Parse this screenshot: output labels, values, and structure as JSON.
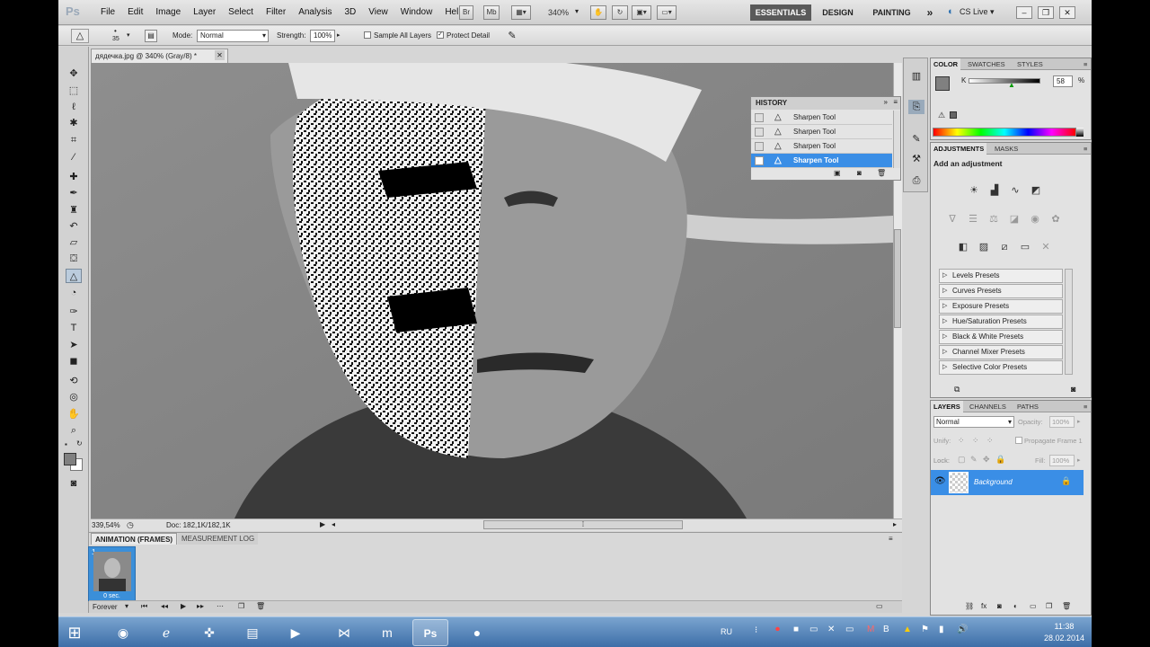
{
  "app": {
    "logo": "Ps",
    "menu": [
      "File",
      "Edit",
      "Image",
      "Layer",
      "Select",
      "Filter",
      "Analysis",
      "3D",
      "View",
      "Window",
      "Help"
    ],
    "zoom": "340%",
    "workspaces": [
      "ESSENTIALS",
      "DESIGN",
      "PAINTING"
    ],
    "more": "»",
    "cslive": "CS Live ▾"
  },
  "options": {
    "brush_size": "35",
    "mode_label": "Mode:",
    "mode_value": "Normal",
    "strength_label": "Strength:",
    "strength_value": "100%",
    "sample_all_layers": "Sample All Layers",
    "protect_detail": "Protect Detail"
  },
  "document": {
    "tab_title": "дядечка.jpg @ 340% (Gray/8) *",
    "zoom_status": "339,54%",
    "doc_info": "Doc: 182,1K/182,1K"
  },
  "history": {
    "title": "HISTORY",
    "items": [
      "Sharpen Tool",
      "Sharpen Tool",
      "Sharpen Tool",
      "Sharpen Tool"
    ]
  },
  "color_panel": {
    "tabs": [
      "COLOR",
      "SWATCHES",
      "STYLES"
    ],
    "channel": "K",
    "value": "58",
    "unit": "%"
  },
  "adjustments": {
    "tabs": [
      "ADJUSTMENTS",
      "MASKS"
    ],
    "heading": "Add an adjustment",
    "presets": [
      "Levels Presets",
      "Curves Presets",
      "Exposure Presets",
      "Hue/Saturation Presets",
      "Black & White Presets",
      "Channel Mixer Presets",
      "Selective Color Presets"
    ]
  },
  "layers": {
    "tabs": [
      "LAYERS",
      "CHANNELS",
      "PATHS"
    ],
    "blend": "Normal",
    "opacity_label": "Opacity:",
    "opacity": "100%",
    "unify_label": "Unify:",
    "propagate": "Propagate Frame 1",
    "lock_label": "Lock:",
    "fill_label": "Fill:",
    "fill": "100%",
    "layer_name": "Background"
  },
  "animation": {
    "tabs": [
      "ANIMATION (FRAMES)",
      "MEASUREMENT LOG"
    ],
    "frame_number": "1",
    "frame_delay": "0 sec.",
    "loop": "Forever"
  },
  "taskbar": {
    "lang": "RU",
    "time": "11:38",
    "date": "28.02.2014"
  },
  "colors": {
    "accent": "#3a8ee6",
    "panel": "#e2e2e2"
  }
}
